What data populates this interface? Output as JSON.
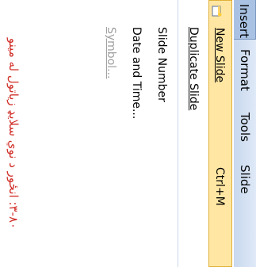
{
  "menubar": {
    "items": [
      {
        "label": "Insert"
      },
      {
        "label": "Format"
      },
      {
        "label": "Tools"
      },
      {
        "label": "Slide"
      }
    ]
  },
  "insert_menu": {
    "items": [
      {
        "label": "New Slide",
        "shortcut": "Ctrl+M",
        "icon": "new-slide-icon"
      },
      {
        "label": "Duplicate Slide"
      },
      {
        "label": "Slide Number"
      },
      {
        "label": "Date and Time..."
      },
      {
        "label": "Symbol..."
      }
    ]
  },
  "caption": "۳-۸۰: انځور د نوي سلايډ زياتول له مينو",
  "colors": {
    "highlight": "#ffe7a3",
    "highlight_border": "#e0b03a",
    "caption": "#d1302a",
    "menubar_active": "#a9c2e3"
  }
}
